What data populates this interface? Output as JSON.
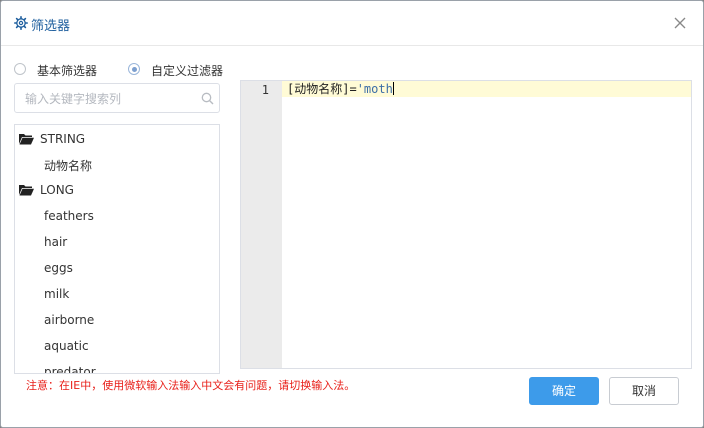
{
  "dialog": {
    "title": "筛选器"
  },
  "modes": [
    {
      "label": "基本筛选器",
      "checked": false
    },
    {
      "label": "自定义过滤器",
      "checked": true
    }
  ],
  "search": {
    "placeholder": "输入关键字搜索列"
  },
  "tree": {
    "groups": [
      {
        "label": "STRING",
        "children": [
          "动物名称"
        ]
      },
      {
        "label": "LONG",
        "children": [
          "feathers",
          "hair",
          "eggs",
          "milk",
          "airborne",
          "aquatic",
          "predator"
        ]
      }
    ]
  },
  "editor": {
    "line_number": "1",
    "code_field": "[动物名称]=",
    "code_string": "'moth"
  },
  "note": "注意：在IE中，使用微软输入法输入中文会有问题，请切换输入法。",
  "buttons": {
    "ok": "确定",
    "cancel": "取消"
  },
  "colors": {
    "accent": "#3d9bea",
    "warning": "#e8201a",
    "title": "#1f5f9e"
  },
  "icons": {
    "header": "gear-icon",
    "close": "close-icon",
    "search": "search-icon",
    "group": "folder-icon"
  }
}
